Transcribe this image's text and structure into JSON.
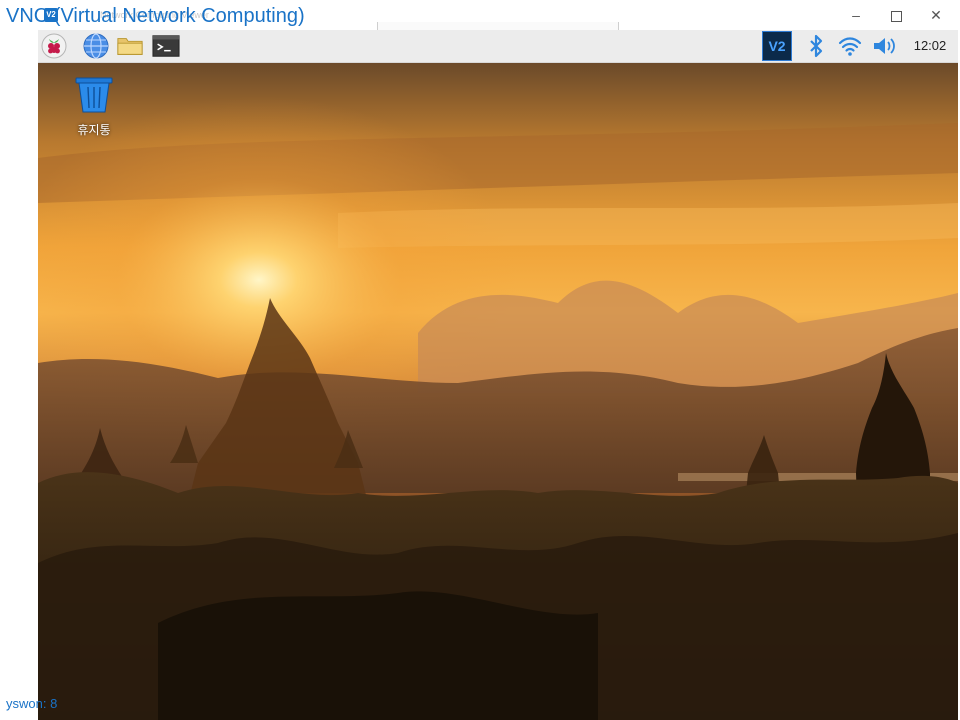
{
  "window": {
    "title": "VNC (Virtual Network Computing)",
    "ghost_text": "Network Computing Viewer",
    "title_icon_text": "V2",
    "minimize_glyph": "–",
    "close_glyph": "✕"
  },
  "panel": {
    "launchers": [
      {
        "name": "raspberry-menu-icon"
      },
      {
        "name": "web-browser-icon"
      },
      {
        "name": "file-manager-icon"
      },
      {
        "name": "terminal-icon"
      }
    ],
    "tray": {
      "vnc_label": "V2",
      "clock": "12:02"
    }
  },
  "desktop": {
    "icons": [
      {
        "label": "휴지통",
        "icon": "trash-icon"
      }
    ]
  },
  "status": {
    "text": "yswon: 8"
  },
  "colors": {
    "accent": "#1a73c7",
    "panel_bg": "#ececec",
    "tray_blue": "#2e86de"
  }
}
